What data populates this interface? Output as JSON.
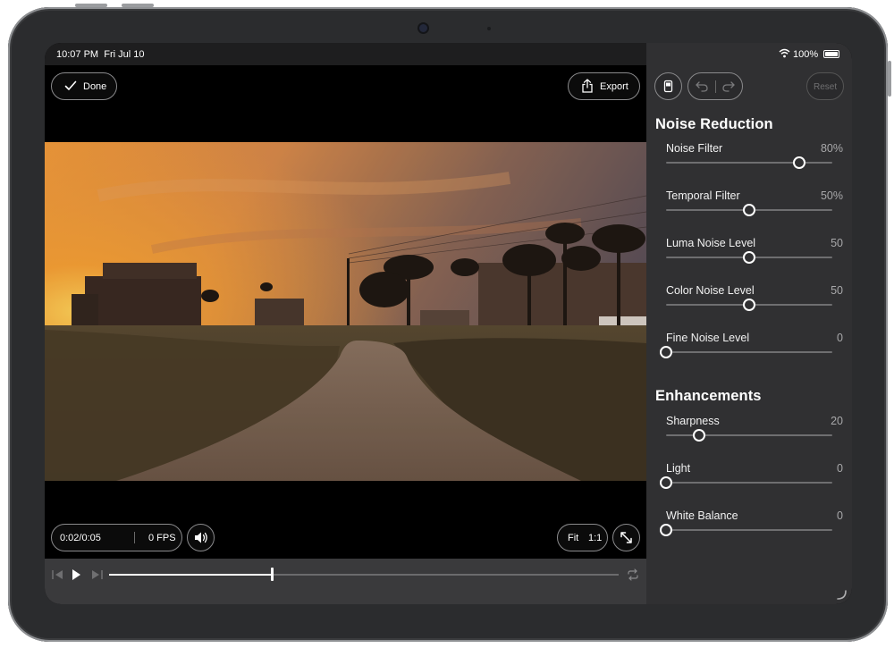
{
  "status_bar": {
    "time": "10:07 PM",
    "date": "Fri Jul 10",
    "battery": "100%"
  },
  "viewer": {
    "done_label": "Done",
    "export_label": "Export",
    "time_display": "0:02/0:05",
    "fps_display": "0 FPS",
    "fit_label": "Fit",
    "one_to_one_label": "1:1",
    "playback_progress": 0.32
  },
  "toolbar": {
    "reset_label": "Reset"
  },
  "noise_reduction": {
    "title": "Noise Reduction",
    "items": [
      {
        "label": "Noise Filter",
        "value": "80%",
        "level": 0.8
      },
      {
        "label": "Temporal Filter",
        "value": "50%",
        "level": 0.5
      },
      {
        "label": "Luma Noise Level",
        "value": "50",
        "level": 0.5
      },
      {
        "label": "Color Noise Level",
        "value": "50",
        "level": 0.5
      },
      {
        "label": "Fine Noise Level",
        "value": "0",
        "level": 0.0
      }
    ]
  },
  "enhancements": {
    "title": "Enhancements",
    "items": [
      {
        "label": "Sharpness",
        "value": "20",
        "level": 0.2
      },
      {
        "label": "Light",
        "value": "0",
        "level": 0.0
      },
      {
        "label": "White Balance",
        "value": "0",
        "level": 0.0
      }
    ]
  },
  "colors": {
    "panel_bg": "#303032",
    "accent": "#ffffff",
    "sky_glow": "#f59a2c"
  }
}
